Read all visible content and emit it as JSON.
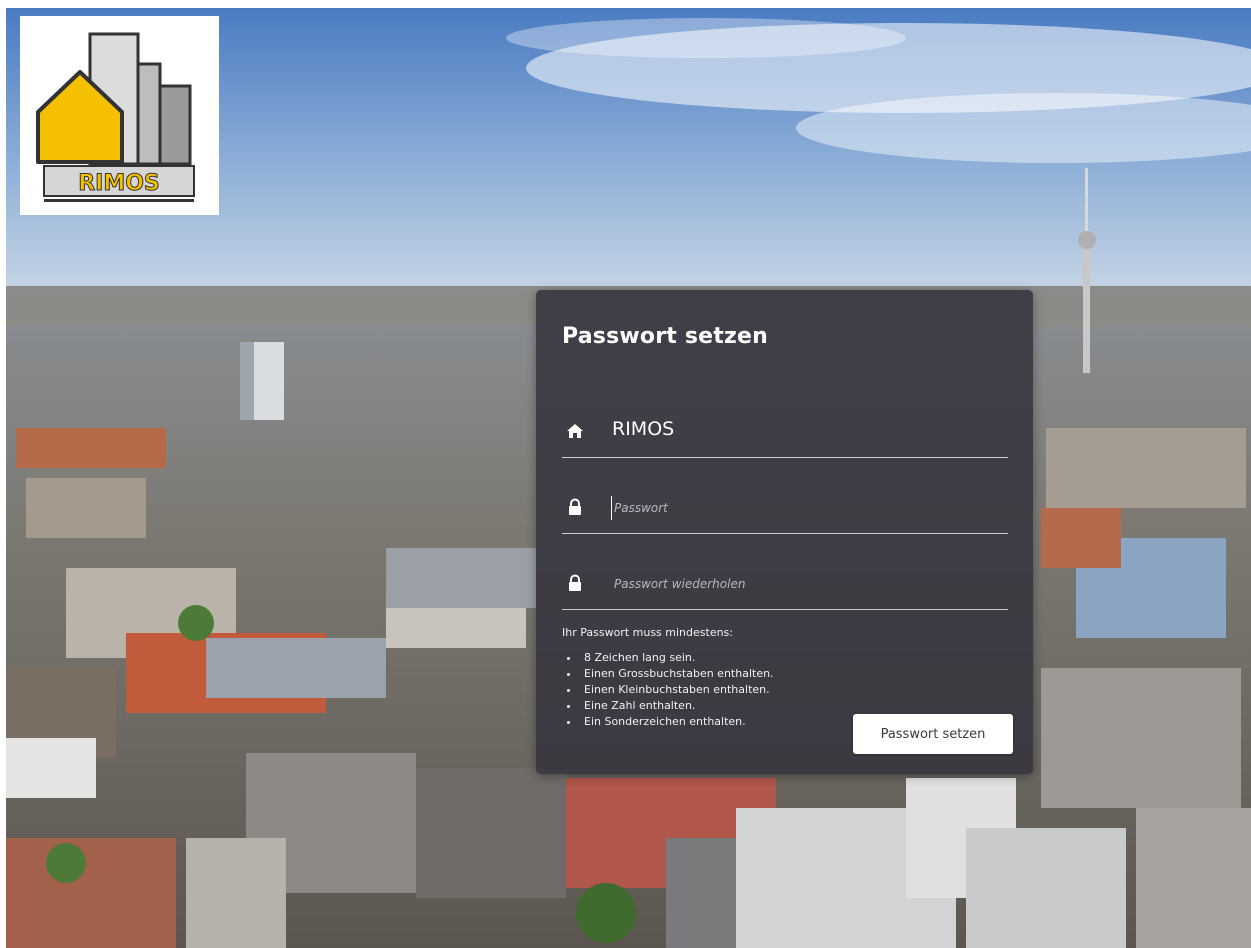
{
  "logo": {
    "name": "RIMOS",
    "accent_color": "#f5c000"
  },
  "form": {
    "title": "Passwort setzen",
    "company": {
      "icon": "home-icon",
      "value": "RIMOS"
    },
    "password": {
      "icon": "lock-icon",
      "placeholder": "Passwort",
      "value": ""
    },
    "password_repeat": {
      "icon": "lock-icon",
      "placeholder": "Passwort wiederholen",
      "value": ""
    },
    "requirements_heading": "Ihr Passwort muss mindestens:",
    "requirements": [
      "8 Zeichen lang sein.",
      "Einen Grossbuchstaben enthalten.",
      "Einen Kleinbuchstaben enthalten.",
      "Eine Zahl enthalten.",
      "Ein Sonderzeichen enthalten."
    ],
    "submit_label": "Passwort setzen"
  },
  "colors": {
    "panel_background": "#34323c",
    "sky_top": "#4a7bc2",
    "sky_horizon": "#c9d6e6",
    "button_background": "#ffffff"
  }
}
